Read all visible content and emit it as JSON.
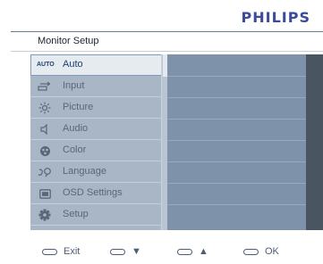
{
  "brand": "PHILIPS",
  "header": {
    "title": "Monitor Setup"
  },
  "menu": {
    "items": [
      {
        "label": "Auto",
        "icon": "auto-icon",
        "icon_text": "AUTO",
        "selected": true
      },
      {
        "label": "Input",
        "icon": "input-icon"
      },
      {
        "label": "Picture",
        "icon": "picture-icon"
      },
      {
        "label": "Audio",
        "icon": "audio-icon"
      },
      {
        "label": "Color",
        "icon": "color-icon"
      },
      {
        "label": "Language",
        "icon": "language-icon"
      },
      {
        "label": "OSD Settings",
        "icon": "osd-icon"
      },
      {
        "label": "Setup",
        "icon": "setup-icon"
      }
    ]
  },
  "footer": {
    "exit_label": "Exit",
    "down_label": "▼",
    "up_label": "▲",
    "ok_label": "OK"
  },
  "colors": {
    "brand": "#3b4a9a",
    "menu_bg": "#a8b6c5",
    "panel_bg": "#7e93aa",
    "selected_bg": "#e6ebf0",
    "footer_icon": "#4e5d75"
  }
}
